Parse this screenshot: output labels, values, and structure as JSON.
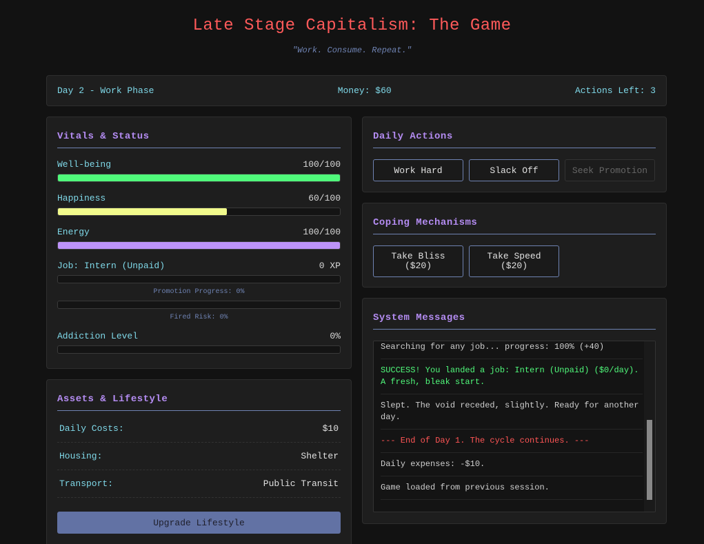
{
  "header": {
    "title": "Late Stage Capitalism: The Game",
    "subtitle": "\"Work. Consume. Repeat.\""
  },
  "status": {
    "day": "Day 2 - Work Phase",
    "money": "Money: $60",
    "actions_left": "Actions Left: 3"
  },
  "vitals": {
    "title": "Vitals & Status",
    "wellbeing": {
      "label": "Well-being",
      "value": "100/100",
      "percent": 100,
      "color": "#50fa7b"
    },
    "happiness": {
      "label": "Happiness",
      "value": "60/100",
      "percent": 60,
      "color": "#f1fa8c"
    },
    "energy": {
      "label": "Energy",
      "value": "100/100",
      "percent": 100,
      "color": "#bd93f9"
    },
    "job": {
      "label": "Job: Intern (Unpaid)",
      "value": "0 XP"
    },
    "promotion": {
      "note": "Promotion Progress: 0%",
      "percent": 0
    },
    "fired": {
      "note": "Fired Risk: 0%",
      "percent": 0
    },
    "addiction": {
      "label": "Addiction Level",
      "value": "0%",
      "percent": 0
    }
  },
  "assets": {
    "title": "Assets & Lifestyle",
    "rows": [
      {
        "key": "Daily Costs:",
        "value": "$10"
      },
      {
        "key": "Housing:",
        "value": "Shelter"
      },
      {
        "key": "Transport:",
        "value": "Public Transit"
      }
    ],
    "upgrade_label": "Upgrade Lifestyle"
  },
  "actions": {
    "title": "Daily Actions",
    "work": "Work Hard",
    "slack": "Slack Off",
    "promote": "Seek Promotion"
  },
  "coping": {
    "title": "Coping Mechanisms",
    "bliss": {
      "name": "Take Bliss",
      "price": "($20)"
    },
    "speed": {
      "name": "Take Speed",
      "price": "($20)"
    }
  },
  "messages": {
    "title": "System Messages",
    "items": [
      {
        "text": "Searching for any job... progress: 100% (+40)",
        "kind": "normal"
      },
      {
        "text": "SUCCESS! You landed a job: Intern (Unpaid) ($0/day). A fresh, bleak start.",
        "kind": "success"
      },
      {
        "text": "Slept. The void receded, slightly. Ready for another day.",
        "kind": "normal"
      },
      {
        "text": "--- End of Day 1. The cycle continues. ---",
        "kind": "danger"
      },
      {
        "text": "Daily expenses: -$10.",
        "kind": "normal"
      },
      {
        "text": "Game loaded from previous session.",
        "kind": "normal"
      }
    ]
  }
}
